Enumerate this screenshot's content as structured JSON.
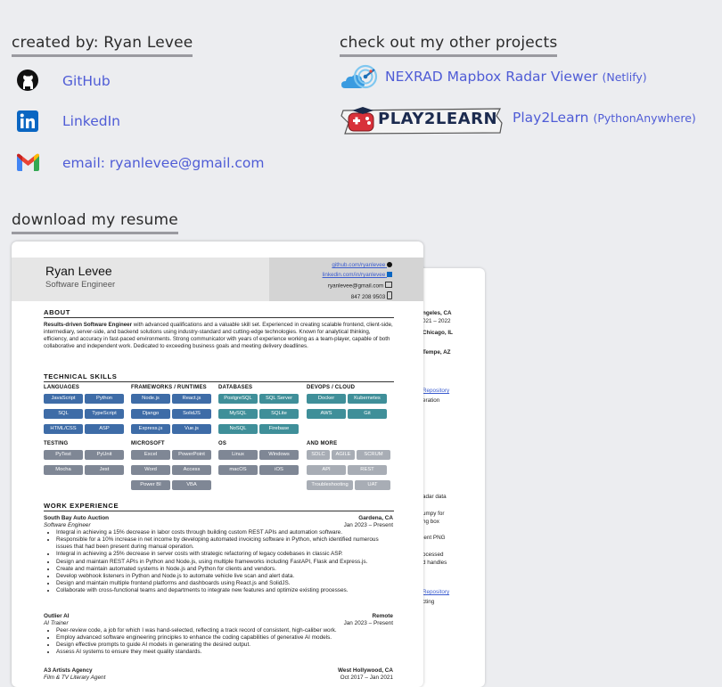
{
  "left_heading": "created by: Ryan Levee",
  "right_heading": "check out my other projects",
  "resume_heading": "download my resume",
  "links": {
    "github": "GitHub",
    "linkedin": "LinkedIn",
    "email": "email: ryanlevee@gmail.com"
  },
  "projects": [
    {
      "name": "NEXRAD Mapbox Radar Viewer",
      "host": "(Netlify)"
    },
    {
      "name": "Play2Learn",
      "host": "(PythonAnywhere)",
      "logo_text": "PLAY2LEARN"
    }
  ],
  "colors": {
    "link": "#4f5cd6",
    "heading_underline": "#9a9aa0",
    "chip_blue": "#3e6ca7",
    "chip_teal": "#3f8f99",
    "chip_gray": "#7f8795"
  },
  "resume": {
    "name": "Ryan Levee",
    "title": "Software Engineer",
    "contact": [
      "github.com/ryanlevee",
      "linkedin.com/in/ryanlevee",
      "ryanlevee@gmail.com",
      "847 208 9503"
    ],
    "about_title": "ABOUT",
    "about_lead": "Results-driven Software Engineer",
    "about_text": " with advanced qualifications and a valuable skill set. Experienced in creating scalable frontend, client-side, intermediary, server-side, and backend solutions using industry-standard and cutting-edge technologies. Known for analytical thinking, efficiency, and accuracy in fast-paced environments. Strong communicator with years of experience working as a team-player, capable of both collaborative and independent work. Dedicated to exceeding business goals and meeting delivery deadlines.",
    "skills_title": "TECHNICAL SKILLS",
    "skill_groups": [
      {
        "name": "LANGUAGES",
        "items": [
          "JavaScript",
          "Python",
          "SQL",
          "TypeScript",
          "HTML/CSS",
          "ASP"
        ]
      },
      {
        "name": "FRAMEWORKS / RUNTIMES",
        "items": [
          "Node.js",
          "React.js",
          "Django",
          "SolidJS",
          "Express.js",
          "Vue.js"
        ]
      },
      {
        "name": "DATABASES",
        "items": [
          "PostgreSQL",
          "SQL Server",
          "MySQL",
          "SQLite",
          "NoSQL",
          "Firebase"
        ]
      },
      {
        "name": "DEVOPS / CLOUD",
        "items": [
          "Docker",
          "Kubernetes",
          "AWS",
          "Git"
        ]
      },
      {
        "name": "TESTING",
        "items": [
          "PyTest",
          "PyUnit",
          "Mocha",
          "Jest"
        ]
      },
      {
        "name": "MICROSOFT",
        "items": [
          "Excel",
          "PowerPoint",
          "Word",
          "Access",
          "Power BI",
          "VBA"
        ]
      },
      {
        "name": "OS",
        "items": [
          "Linux",
          "Windows",
          "macOS",
          "iOS"
        ]
      },
      {
        "name": "AND MORE",
        "items": [
          "SDLC",
          "AGILE",
          "SCRUM",
          "API",
          "REST",
          "Troubleshooting",
          "UAT"
        ]
      }
    ],
    "work_title": "WORK EXPERIENCE",
    "jobs": [
      {
        "company": "South Bay Auto Auction",
        "location": "Gardena, CA",
        "role": "Software Engineer",
        "dates": "Jan 2023 – Present",
        "bullets": [
          "Integral in achieving a 15% decrease in labor costs through building custom REST APIs and automation software.",
          "Responsible for a 10% increase in net income by developing automated invoicing software in Python, which identified numerous issues that had been present during manual operation.",
          "Integral in achieving a 25% decrease in server costs with strategic refactoring of legacy codebases in classic ASP.",
          "Design and maintain REST APIs in Python and Node.js, using multiple frameworks including FastAPI, Flask and Express.js.",
          "Create and maintain automated systems in Node.js and Python for clients and vendors.",
          "Develop webhook listeners in Python and Node.js to automate vehicle live scan and alert data.",
          "Design and maintain multiple frontend platforms and dashboards using React.js and SolidJS.",
          "Collaborate with cross-functional teams and departments to integrate new features and optimize existing processes."
        ]
      },
      {
        "company": "Outlier AI",
        "location": "Remote",
        "role": "AI Trainer",
        "dates": "Jan 2023 – Present",
        "bullets": [
          "Peer-review code, a job for which I was hand-selected, reflecting a track record of consistent, high-caliber work.",
          "Employ advanced software engineering principles to enhance the coding capabilities of generative AI models.",
          "Design effective prompts to guide AI models in generating the desired output.",
          "Assess AI systems to ensure they meet quality standards."
        ]
      },
      {
        "company": "A3 Artists Agency",
        "location": "West Hollywood, CA",
        "role": "Film & TV Literary Agent",
        "dates": "Oct 2017 – Jan 2021"
      }
    ],
    "back_page": [
      "ngeles, CA",
      "021 – 2022",
      "Chicago, IL",
      "Tempe, AZ",
      "Repository",
      "eration",
      "adar data",
      "umpy for",
      "ng box",
      "ient PNG",
      "ocessed",
      "d handles",
      "Repository",
      "cting"
    ]
  }
}
